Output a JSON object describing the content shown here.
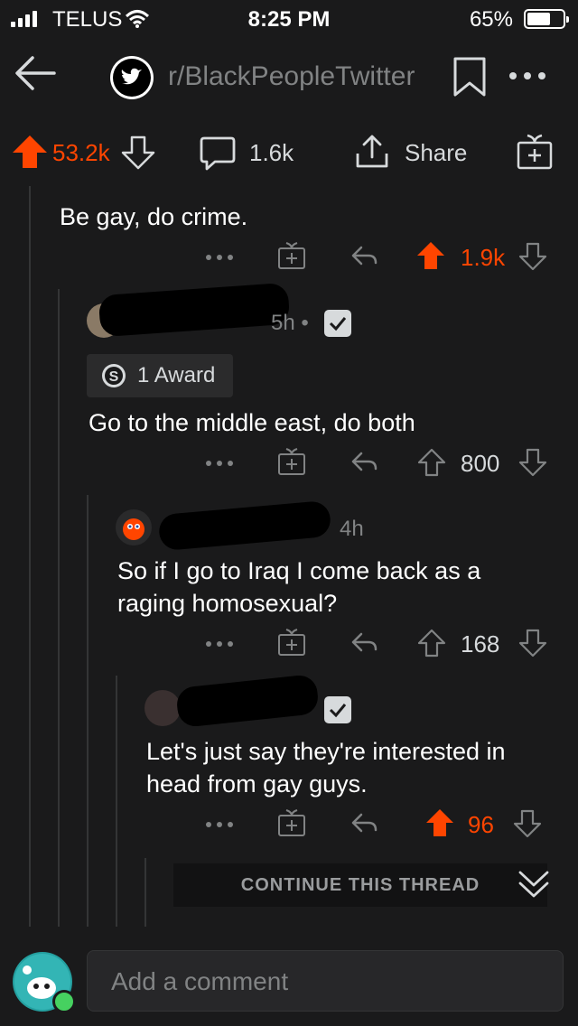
{
  "status_bar": {
    "carrier": "TELUS",
    "time": "8:25 PM",
    "battery": "65%",
    "battery_level": 0.65
  },
  "header": {
    "subreddit": "r/BlackPeopleTwitter"
  },
  "post_actions": {
    "upvotes": "53.2k",
    "comments": "1.6k",
    "share_label": "Share"
  },
  "comments": [
    {
      "body": "Be gay, do crime.",
      "votes": "1.9k",
      "upvoted": true
    },
    {
      "meta": "5h •",
      "award": "1 Award",
      "body": "Go to the middle east, do both",
      "votes": "800",
      "upvoted": false
    },
    {
      "meta": "4h",
      "body": "So if I go to Iraq I come back as a raging homosexual?",
      "votes": "168",
      "upvoted": false
    },
    {
      "body": "Let's just say they're interested in head from gay guys.",
      "votes": "96",
      "upvoted": true
    }
  ],
  "continue_thread": "CONTINUE THIS THREAD",
  "composer": {
    "placeholder": "Add a comment"
  },
  "colors": {
    "background": "#1a1a1b",
    "upvote": "#ff4500",
    "text": "#d7dadc",
    "muted": "#818384"
  }
}
